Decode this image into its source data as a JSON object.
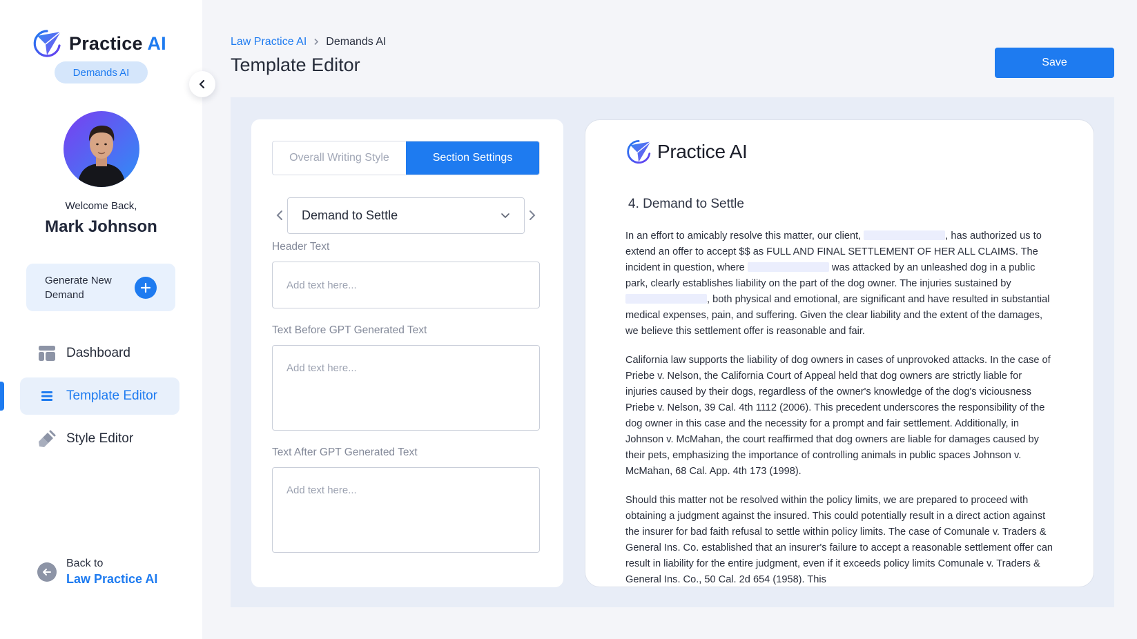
{
  "brand": {
    "name_main": "Practice",
    "name_accent": "AI",
    "app_pill": "Demands AI"
  },
  "user": {
    "welcome": "Welcome Back,",
    "name": "Mark Johnson"
  },
  "sidebar": {
    "generate_button": "Generate New Demand",
    "nav": [
      {
        "label": "Dashboard",
        "icon": "dashboard-icon",
        "active": false
      },
      {
        "label": "Template Editor",
        "icon": "list-icon",
        "active": true
      },
      {
        "label": "Style Editor",
        "icon": "brush-icon",
        "active": false
      }
    ],
    "back": {
      "sub": "Back to",
      "main": "Law Practice AI"
    }
  },
  "header": {
    "breadcrumb": [
      "Law Practice AI",
      "Demands AI"
    ],
    "title": "Template Editor",
    "save_label": "Save"
  },
  "editor": {
    "tabs": [
      "Overall Writing Style",
      "Section Settings"
    ],
    "active_tab": 1,
    "section_select": "Demand to Settle",
    "fields": [
      {
        "label": "Header Text",
        "placeholder": "Add text here..."
      },
      {
        "label": "Text Before GPT Generated Text",
        "placeholder": "Add text here..."
      },
      {
        "label": "Text After GPT Generated Text",
        "placeholder": "Add text here..."
      }
    ]
  },
  "preview": {
    "logo_text": "Practice AI",
    "heading": "4. Demand to Settle",
    "p1": {
      "a": "In an effort to amicably resolve this matter, our client, ",
      "b": ", has authorized us to extend an offer to accept $$ as FULL AND FINAL SETTLEMENT OF HER ALL CLAIMS. The incident in question, where ",
      "c": " was attacked by an unleashed dog in a public park, clearly establishes liability on the part of the dog owner. The injuries sustained by ",
      "d": ", both physical and emotional, are significant and have resulted in substantial medical expenses, pain, and suffering. Given the clear liability and the extent of the damages, we believe this settlement offer is reasonable and fair."
    },
    "p2": "California law supports the liability of dog owners in cases of unprovoked attacks. In the case of Priebe v. Nelson, the California Court of Appeal held that dog owners are strictly liable for injuries caused by their dogs, regardless of the owner's knowledge of the dog's viciousness Priebe v. Nelson, 39 Cal. 4th 1112 (2006). This precedent underscores the responsibility of the dog owner in this case and the necessity for a prompt and fair settlement. Additionally, in Johnson v. McMahan, the court reaffirmed that dog owners are liable for damages caused by their pets, emphasizing the importance of controlling animals in public spaces Johnson v. McMahan, 68 Cal. App. 4th 173 (1998).",
    "p3": "Should this matter not be resolved within the policy limits, we are prepared to proceed with obtaining a judgment against the insured. This could potentially result in a direct action against the insurer for bad faith refusal to settle within policy limits. The case of Comunale v. Traders & General Ins. Co. established that an insurer's failure to accept a reasonable settlement offer can result in liability for the entire judgment, even if it exceeds policy limits Comunale v. Traders & General Ins. Co., 50 Cal. 2d 654 (1958). This"
  },
  "colors": {
    "accent": "#1e7bf0",
    "redaction": "#ebeefd"
  }
}
